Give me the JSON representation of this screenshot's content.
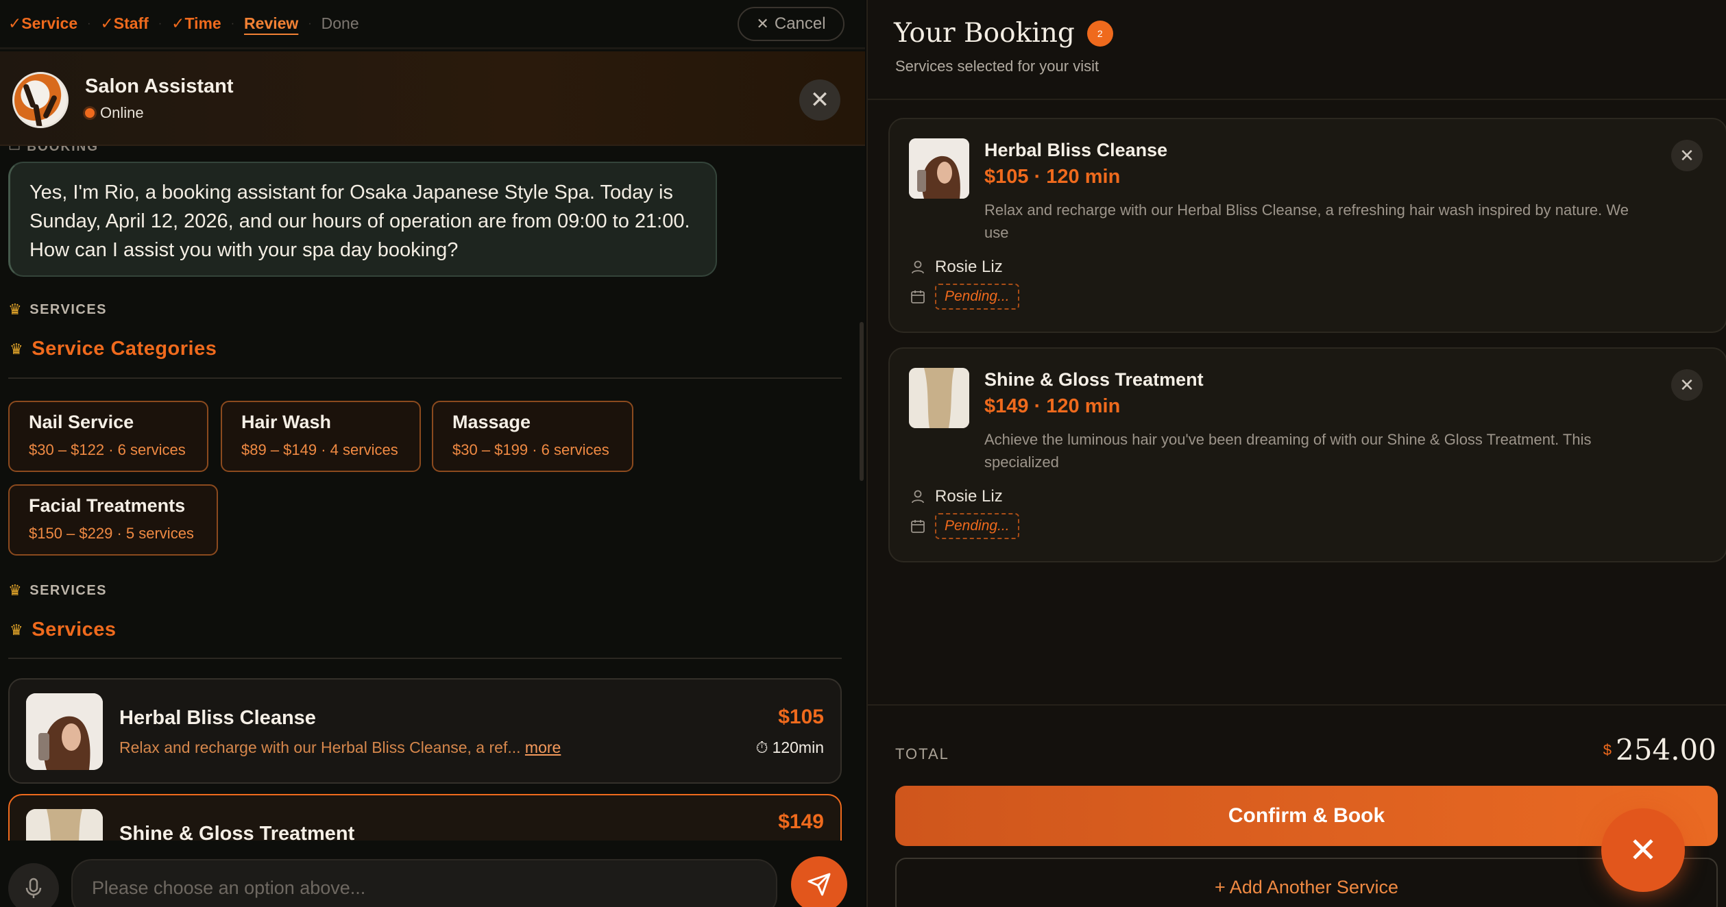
{
  "steps": [
    {
      "label": "✓Service",
      "state": "done"
    },
    {
      "label": "✓Staff",
      "state": "done"
    },
    {
      "label": "✓Time",
      "state": "done"
    },
    {
      "label": "Review",
      "state": "current"
    },
    {
      "label": "Done",
      "state": "todo"
    }
  ],
  "cancel_label": "Cancel",
  "assistant": {
    "name": "Salon Assistant",
    "status": "Online"
  },
  "chat": {
    "partial_label": "BOOKING",
    "message": "Yes, I'm Rio, a booking assistant for Osaka Japanese Style Spa. Today is Sunday, April 12, 2026, and our hours of operation are from 09:00 to 21:00. How can I assist you with your spa day booking?",
    "section1_label": "SERVICES",
    "categories_title": "Service Categories",
    "categories": [
      {
        "name": "Nail Service",
        "meta": "$30 – $122 · 6 services"
      },
      {
        "name": "Hair Wash",
        "meta": "$89 – $149 · 4 services"
      },
      {
        "name": "Massage",
        "meta": "$30 – $199 · 6 services"
      },
      {
        "name": "Facial Treatments",
        "meta": "$150 – $229 · 5 services"
      }
    ],
    "section2_label": "SERVICES",
    "services_title": "Services",
    "services": [
      {
        "name": "Herbal Bliss Cleanse",
        "desc": "Relax and recharge with our Herbal Bliss Cleanse, a ref...",
        "more": "more",
        "price": "$105",
        "duration": "120min"
      },
      {
        "name": "Shine & Gloss Treatment",
        "price": "$149"
      }
    ],
    "input_placeholder": "Please choose an option above..."
  },
  "booking": {
    "title": "Your Booking",
    "count": "2",
    "subtitle": "Services selected for your visit",
    "items": [
      {
        "name": "Herbal Bliss Cleanse",
        "price": "$105 · 120 min",
        "desc": "Relax and recharge with our Herbal Bliss Cleanse, a refreshing hair wash inspired by nature. We use",
        "staff": "Rosie Liz",
        "date": "Pending..."
      },
      {
        "name": "Shine & Gloss Treatment",
        "price": "$149 · 120 min",
        "desc": "Achieve the luminous hair you've been dreaming of with our Shine & Gloss Treatment. This specialized",
        "staff": "Rosie Liz",
        "date": "Pending..."
      }
    ],
    "total_label": "TOTAL",
    "total_currency": "$",
    "total_amount": "254.00",
    "confirm_label": "Confirm & Book",
    "add_label": "+ Add Another Service"
  },
  "colors": {
    "accent": "#ef6a1d",
    "background": "#0d0e0b",
    "panel": "#14110d"
  },
  "icons": [
    "close-icon",
    "mic-icon",
    "send-icon",
    "clock-icon",
    "user-icon",
    "calendar-icon",
    "spa-emoji-icon"
  ]
}
